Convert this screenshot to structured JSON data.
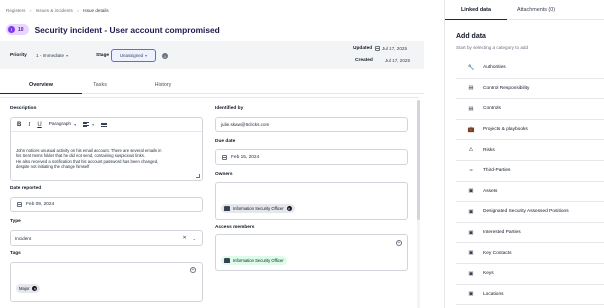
{
  "breadcrumb": [
    "Registers",
    "Issues & incidents",
    "Issue details"
  ],
  "issue": {
    "number": "10",
    "title": "Security incident - User account compromised"
  },
  "meta": {
    "priority_label": "Priority",
    "priority_value": "1 - Immediate",
    "stage_label": "Stage",
    "stage_value": "Unassigned",
    "updated_label": "Updated",
    "updated_value": "Jul 17, 2025",
    "created_label": "Created",
    "created_value": "Jul 17, 2025"
  },
  "tabs": [
    "Overview",
    "Tasks",
    "History"
  ],
  "form": {
    "description_label": "Description",
    "editor_paragraph": "Paragraph",
    "description_text": [
      "John notices unusual activity on his email account. There are several emails in",
      "his Sent Items folder that he did not send, containing suspicious links.",
      "He also received a notification that his account password has been changed,",
      "despite not initiating the change himself"
    ],
    "date_reported_label": "Date reported",
    "date_reported_value": "Feb 09, 2024",
    "type_label": "Type",
    "type_value": "Incident",
    "tags_label": "Tags",
    "tags": [
      "Major"
    ],
    "identified_by_label": "Identified by",
    "identified_by_value": "julie.skaw@6clicks.com",
    "due_date_label": "Due date",
    "due_date_value": "Feb 15, 2024",
    "owners_label": "Owners",
    "owners": [
      "Information Security Officer"
    ],
    "access_members_label": "Access members",
    "access_members": [
      "Information Security Officer"
    ]
  },
  "right_panel": {
    "tabs": [
      "Linked data",
      "Attachments (0)"
    ],
    "title": "Add data",
    "subtitle": "Start by selecting a category to add",
    "categories": [
      {
        "label": "Authorities",
        "icon": "wrench-icon"
      },
      {
        "label": "Control Responsibility",
        "icon": "document-icon"
      },
      {
        "label": "Controls",
        "icon": "document-icon"
      },
      {
        "label": "Projects & playbooks",
        "icon": "briefcase-icon"
      },
      {
        "label": "Risks",
        "icon": "warning-icon"
      },
      {
        "label": "Third-Parties",
        "icon": "users-icon"
      },
      {
        "label": "Assets",
        "icon": "asset-icon"
      },
      {
        "label": "Designated Security Assessed Positions",
        "icon": "asset-icon"
      },
      {
        "label": "Interested Parties",
        "icon": "asset-icon"
      },
      {
        "label": "Key Contacts",
        "icon": "asset-icon"
      },
      {
        "label": "Keys",
        "icon": "asset-icon"
      },
      {
        "label": "Locations",
        "icon": "asset-icon"
      }
    ]
  }
}
